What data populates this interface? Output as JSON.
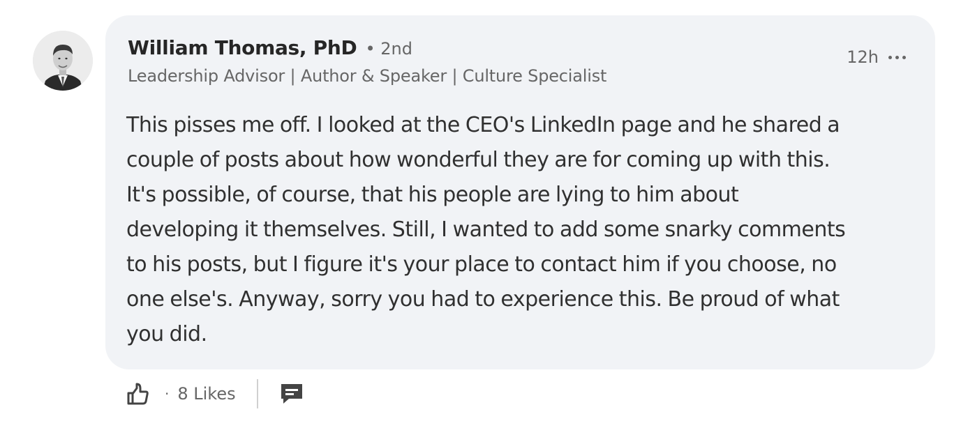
{
  "comment": {
    "author": {
      "name": "William Thomas, PhD",
      "degree": "• 2nd",
      "headline": "Leadership Advisor | Author & Speaker | Culture Specialist",
      "avatar_icon": "profile-photo"
    },
    "timestamp": "12h",
    "more_icon": "ellipsis-icon",
    "text": "This pisses me off. I looked at the CEO's LinkedIn page and he shared a\ncouple of posts about how wonderful they are for coming up with this.\nIt's possible, of course, that his people are lying to him about\ndeveloping it themselves. Still, I wanted to add some snarky comments\nto his posts, but I figure it's your place to contact him if you choose, no\none else's. Anyway, sorry you had to experience this. Be proud of what\nyou did.",
    "actions": {
      "like_icon": "thumbs-up-icon",
      "separator": "·",
      "likes": "8 Likes",
      "reply_icon": "comment-icon"
    }
  },
  "colors": {
    "bubble_bg": "#f1f3f6",
    "text_primary": "#262626",
    "text_secondary": "#666666"
  }
}
